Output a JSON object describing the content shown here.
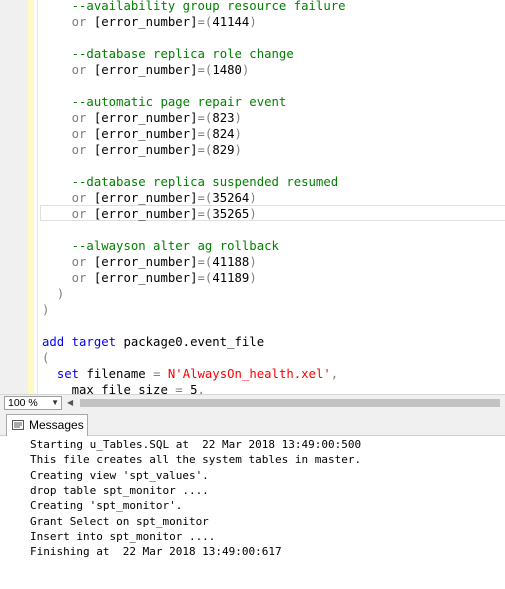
{
  "editor": {
    "lines": [
      {
        "indent": "    ",
        "parts": [
          {
            "cls": "cm",
            "text": "--availability group resource failure"
          }
        ]
      },
      {
        "indent": "    ",
        "parts": [
          {
            "cls": "gy",
            "text": "or "
          },
          {
            "cls": "pl",
            "text": "[error_number]"
          },
          {
            "cls": "gy",
            "text": "=("
          },
          {
            "cls": "pl",
            "text": "41144"
          },
          {
            "cls": "gy",
            "text": ")"
          }
        ]
      },
      {
        "indent": "",
        "parts": []
      },
      {
        "indent": "    ",
        "parts": [
          {
            "cls": "cm",
            "text": "--database replica role change"
          }
        ]
      },
      {
        "indent": "    ",
        "parts": [
          {
            "cls": "gy",
            "text": "or "
          },
          {
            "cls": "pl",
            "text": "[error_number]"
          },
          {
            "cls": "gy",
            "text": "=("
          },
          {
            "cls": "pl",
            "text": "1480"
          },
          {
            "cls": "gy",
            "text": ")"
          }
        ]
      },
      {
        "indent": "",
        "parts": []
      },
      {
        "indent": "    ",
        "parts": [
          {
            "cls": "cm",
            "text": "--automatic page repair event"
          }
        ]
      },
      {
        "indent": "    ",
        "parts": [
          {
            "cls": "gy",
            "text": "or "
          },
          {
            "cls": "pl",
            "text": "[error_number]"
          },
          {
            "cls": "gy",
            "text": "=("
          },
          {
            "cls": "pl",
            "text": "823"
          },
          {
            "cls": "gy",
            "text": ")"
          }
        ]
      },
      {
        "indent": "    ",
        "parts": [
          {
            "cls": "gy",
            "text": "or "
          },
          {
            "cls": "pl",
            "text": "[error_number]"
          },
          {
            "cls": "gy",
            "text": "=("
          },
          {
            "cls": "pl",
            "text": "824"
          },
          {
            "cls": "gy",
            "text": ")"
          }
        ]
      },
      {
        "indent": "    ",
        "parts": [
          {
            "cls": "gy",
            "text": "or "
          },
          {
            "cls": "pl",
            "text": "[error_number]"
          },
          {
            "cls": "gy",
            "text": "=("
          },
          {
            "cls": "pl",
            "text": "829"
          },
          {
            "cls": "gy",
            "text": ")"
          }
        ]
      },
      {
        "indent": "",
        "parts": []
      },
      {
        "indent": "    ",
        "parts": [
          {
            "cls": "cm",
            "text": "--database replica suspended resumed"
          }
        ]
      },
      {
        "indent": "    ",
        "parts": [
          {
            "cls": "gy",
            "text": "or "
          },
          {
            "cls": "pl",
            "text": "[error_number]"
          },
          {
            "cls": "gy",
            "text": "=("
          },
          {
            "cls": "pl",
            "text": "35264"
          },
          {
            "cls": "gy",
            "text": ")"
          }
        ]
      },
      {
        "indent": "    ",
        "parts": [
          {
            "cls": "gy",
            "text": "or "
          },
          {
            "cls": "pl",
            "text": "[error_number]"
          },
          {
            "cls": "gy",
            "text": "=("
          },
          {
            "cls": "pl",
            "text": "35265"
          },
          {
            "cls": "gy",
            "text": ")"
          }
        ]
      },
      {
        "indent": "",
        "parts": []
      },
      {
        "indent": "    ",
        "parts": [
          {
            "cls": "cm",
            "text": "--alwayson alter ag rollback"
          }
        ]
      },
      {
        "indent": "    ",
        "parts": [
          {
            "cls": "gy",
            "text": "or "
          },
          {
            "cls": "pl",
            "text": "[error_number]"
          },
          {
            "cls": "gy",
            "text": "=("
          },
          {
            "cls": "pl",
            "text": "41188"
          },
          {
            "cls": "gy",
            "text": ")"
          }
        ]
      },
      {
        "indent": "    ",
        "parts": [
          {
            "cls": "gy",
            "text": "or "
          },
          {
            "cls": "pl",
            "text": "[error_number]"
          },
          {
            "cls": "gy",
            "text": "=("
          },
          {
            "cls": "pl",
            "text": "41189"
          },
          {
            "cls": "gy",
            "text": ")"
          }
        ]
      },
      {
        "indent": "  ",
        "parts": [
          {
            "cls": "gy",
            "text": ")"
          }
        ]
      },
      {
        "indent": "",
        "parts": [
          {
            "cls": "gy",
            "text": ")"
          }
        ]
      },
      {
        "indent": "",
        "parts": []
      },
      {
        "indent": "",
        "parts": [
          {
            "cls": "kw",
            "text": "add target "
          },
          {
            "cls": "pl",
            "text": "package0.event_file"
          }
        ]
      },
      {
        "indent": "",
        "parts": [
          {
            "cls": "gy",
            "text": "("
          }
        ]
      },
      {
        "indent": "  ",
        "parts": [
          {
            "cls": "kw",
            "text": "set "
          },
          {
            "cls": "pl",
            "text": "filename "
          },
          {
            "cls": "gy",
            "text": "= "
          },
          {
            "cls": "st",
            "text": "N'AlwaysOn_health.xel'"
          },
          {
            "cls": "gy",
            "text": ","
          }
        ]
      },
      {
        "indent": "    ",
        "parts": [
          {
            "cls": "pl",
            "text": "max_file_size "
          },
          {
            "cls": "gy",
            "text": "= "
          },
          {
            "cls": "pl",
            "text": "5"
          },
          {
            "cls": "gy",
            "text": ","
          }
        ]
      }
    ]
  },
  "statusbar": {
    "zoom": "100 %"
  },
  "results": {
    "tab_label": "Messages",
    "messages": [
      "Starting u_Tables.SQL at  22 Mar 2018 13:49:00:500",
      "This file creates all the system tables in master.",
      "Creating view 'spt_values'.",
      "drop table spt_monitor ....",
      "Creating 'spt_monitor'.",
      "Grant Select on spt_monitor",
      "Insert into spt_monitor ....",
      "Finishing at  22 Mar 2018 13:49:00:617"
    ]
  },
  "colors": {
    "comment": "#008000",
    "keyword": "#0000ff",
    "string": "#ff0000",
    "operator": "#808080",
    "gutter": "#f0f0f0",
    "change_bar": "#fdfac2"
  }
}
